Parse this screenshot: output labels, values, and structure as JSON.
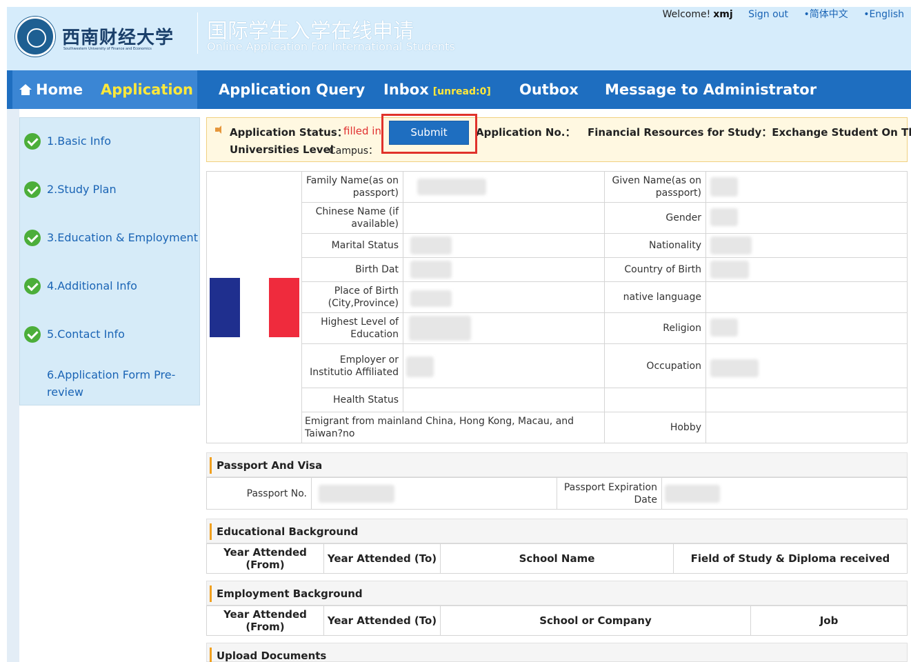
{
  "header": {
    "logo_cn": "西南财经大学",
    "logo_en": "Southwestern University of Finance and Economics",
    "title_cn": "国际学生入学在线申请",
    "title_en": "Online Application For International Students",
    "welcome": "Welcome!",
    "username": "xmj",
    "sign_out": "Sign out",
    "lang_cn": "•简体中文",
    "lang_en": "•English"
  },
  "nav": {
    "home": "Home",
    "application": "Application",
    "query": "Application Query",
    "inbox": "Inbox",
    "unread": "[unread:0]",
    "outbox": "Outbox",
    "message": "Message to Administrator"
  },
  "sidebar": {
    "items": [
      {
        "label": "1.Basic Info"
      },
      {
        "label": "2.Study Plan"
      },
      {
        "label": "3.Education & Employment"
      },
      {
        "label": "4.Additional Info"
      },
      {
        "label": "5.Contact Info"
      },
      {
        "label": "6.Application Form Pre-review"
      }
    ]
  },
  "status": {
    "label": "Application Status：",
    "value": "filled in",
    "submit": "Submit",
    "app_no_label": "Application No.：",
    "financial_label": "Financial Resources for Study：Exchange Student On The",
    "univ_level": "Universities Level",
    "campus_label": "Campus："
  },
  "basic_info": {
    "family_name": "Family Name(as on passport)",
    "given_name": "Given Name(as on passport)",
    "chinese_name": "Chinese Name (if available)",
    "gender": "Gender",
    "marital": "Marital Status",
    "nationality": "Nationality",
    "birth_date": "Birth Dat",
    "country_birth": "Country of Birth",
    "place_birth": "Place of Birth (City,Province)",
    "native_lang": "native language",
    "highest_edu": "Highest Level of Education",
    "religion": "Religion",
    "employer": "Employer or Institutio Affiliated",
    "occupation": "Occupation",
    "health": "Health Status",
    "emigrant": "Emigrant from mainland China, Hong Kong, Macau, and Taiwan?no",
    "hobby": "Hobby"
  },
  "passport": {
    "title": "Passport And Visa",
    "passport_no": "Passport No.",
    "expiration": "Passport Expiration Date"
  },
  "education": {
    "title": "Educational Background",
    "columns": [
      "Year Attended (From)",
      "Year Attended (To)",
      "School Name",
      "Field of Study & Diploma received"
    ]
  },
  "employment": {
    "title": "Employment Background",
    "columns": [
      "Year Attended (From)",
      "Year Attended (To)",
      "School or Company",
      "Job"
    ]
  },
  "upload": {
    "title": "Upload Documents"
  }
}
